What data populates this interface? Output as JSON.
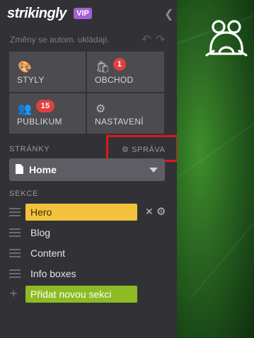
{
  "brand": {
    "logo_text": "strikingly",
    "plan_badge": "VIP"
  },
  "toolbar": {
    "autosave_text": "Změny se autom. ukládají.",
    "undo_icon": "undo-icon",
    "redo_icon": "redo-icon"
  },
  "tiles": [
    {
      "label": "STYLY",
      "icon": "palette-icon",
      "badge": ""
    },
    {
      "label": "OBCHOD",
      "icon": "shopping-bag-icon",
      "badge": "1"
    },
    {
      "label": "PUBLIKUM",
      "icon": "people-icon",
      "badge": "15"
    },
    {
      "label": "NASTAVENÍ",
      "icon": "gear-icon",
      "badge": ""
    }
  ],
  "pages": {
    "section_label": "STRÁNKY",
    "manage_label": "SPRÁVA",
    "selected_page": "Home"
  },
  "sections": {
    "label": "SEKCE",
    "items": [
      {
        "name": "Hero",
        "active": true
      },
      {
        "name": "Blog",
        "active": false
      },
      {
        "name": "Content",
        "active": false
      },
      {
        "name": "Info boxes",
        "active": false
      }
    ],
    "add_label": "Přidat novou sekci"
  },
  "colors": {
    "sidebar_bg": "#323236",
    "tile_bg": "#4b4b50",
    "vip_badge": "#a35fd6",
    "notification_badge": "#e24040",
    "hero_highlight": "#f2c23c",
    "add_section": "#8dbb24",
    "highlight_box": "#e01818"
  }
}
